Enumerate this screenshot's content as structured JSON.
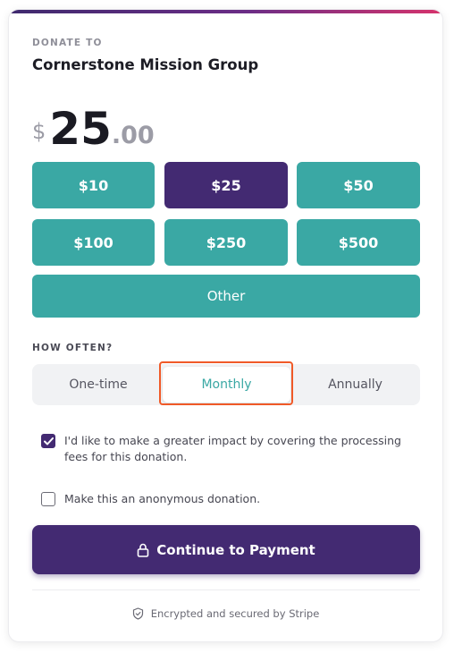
{
  "header": {
    "donate_to_label": "DONATE TO",
    "org_name": "Cornerstone Mission Group"
  },
  "amount": {
    "currency": "$",
    "whole": "25",
    "cents": ".00"
  },
  "preset_amounts": [
    {
      "label": "$10",
      "selected": false
    },
    {
      "label": "$25",
      "selected": true
    },
    {
      "label": "$50",
      "selected": false
    },
    {
      "label": "$100",
      "selected": false
    },
    {
      "label": "$250",
      "selected": false
    },
    {
      "label": "$500",
      "selected": false
    }
  ],
  "other_label": "Other",
  "frequency": {
    "label": "HOW OFTEN?",
    "options": [
      "One-time",
      "Monthly",
      "Annually"
    ],
    "selected": "Monthly"
  },
  "options": {
    "cover_fees": {
      "label": "I'd like to make a greater impact by covering the processing fees for this donation.",
      "checked": true
    },
    "anonymous": {
      "label": "Make this an anonymous donation.",
      "checked": false
    }
  },
  "cta": {
    "label": "Continue to Payment",
    "icon": "lock-icon"
  },
  "footer": {
    "secure_text": "Encrypted and secured by Stripe",
    "icon": "shield-icon"
  },
  "colors": {
    "primary": "#432a72",
    "teal": "#3aa8a4",
    "highlight": "#f05a28"
  }
}
